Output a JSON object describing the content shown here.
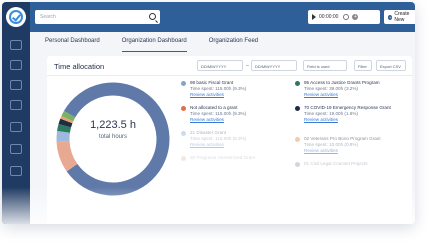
{
  "search": {
    "placeholder": "Search"
  },
  "timer": {
    "value": "00:00:00"
  },
  "create": {
    "label": "Create New"
  },
  "tabs": [
    {
      "label": "Personal Dashboard",
      "active": false
    },
    {
      "label": "Organization Dashboard",
      "active": true
    },
    {
      "label": "Organization Feed",
      "active": false
    }
  ],
  "card": {
    "title": "Time allocation",
    "date_from": "DD/MM/YYYY",
    "date_to": "DD/MM/YYYY",
    "field_filter": "Field is used",
    "filter_label": "Filter",
    "export_label": "Export CSV"
  },
  "total": {
    "value": "1,223.5 h",
    "label": "total hours"
  },
  "legend_left": [
    {
      "name": "98 basic Fiscal Grant",
      "spent": "Time spent: 115.00h (9.3%)",
      "link": "Review activities",
      "color": "#8aa2c8"
    },
    {
      "name": "Not allocated to a grant",
      "spent": "Time spent: 115.00h (9.3%)",
      "link": "Review activities",
      "color": "#e26f4a"
    },
    {
      "name": "21 Disaster Grant",
      "spent": "Time spent: 115.00h (9.3%)",
      "link": "Review activities",
      "color": "#7aa3d6"
    },
    {
      "name": "30 Programs Unrestricted Grant",
      "spent": "",
      "link": "",
      "color": "#b98a58"
    }
  ],
  "legend_right": [
    {
      "name": "95 Access to Justice Grants Program",
      "spent": "Time spent: 39.00h (3.2%)",
      "link": "Review activities",
      "color": "#2c7a60"
    },
    {
      "name": "70 COVID-19 Emergency Response Grant",
      "spent": "Time spent: 19.00h (1.6%)",
      "link": "Review activities",
      "color": "#1f2c45"
    },
    {
      "name": "02 Veterans Pro Bono Program Grant",
      "spent": "Time spent: 10.00h (0.8%)",
      "link": "Review activities",
      "color": "#e8a36a"
    },
    {
      "name": "01 Civil Legal Counsel Projects",
      "spent": "",
      "link": "",
      "color": "#5b6f8f"
    }
  ],
  "donut_slices": [
    {
      "label": "98 basic Fiscal Grant",
      "value": 82,
      "color": "#5f79a8"
    },
    {
      "label": "Not allocated to a grant",
      "value": 9,
      "color": "#e8a993"
    },
    {
      "label": "21 Disaster Grant",
      "value": 3,
      "color": "#9fb9de"
    },
    {
      "label": "95 Access to Justice Grants Program",
      "value": 2,
      "color": "#2c7a60"
    },
    {
      "label": "70 COVID-19 Emergency Response Grant",
      "value": 1.6,
      "color": "#1f2c45"
    },
    {
      "label": "02 Veterans Pro Bono Program Grant",
      "value": 0.8,
      "color": "#e8a36a"
    },
    {
      "label": "other",
      "value": 1.6,
      "color": "#7ab06a"
    }
  ]
}
